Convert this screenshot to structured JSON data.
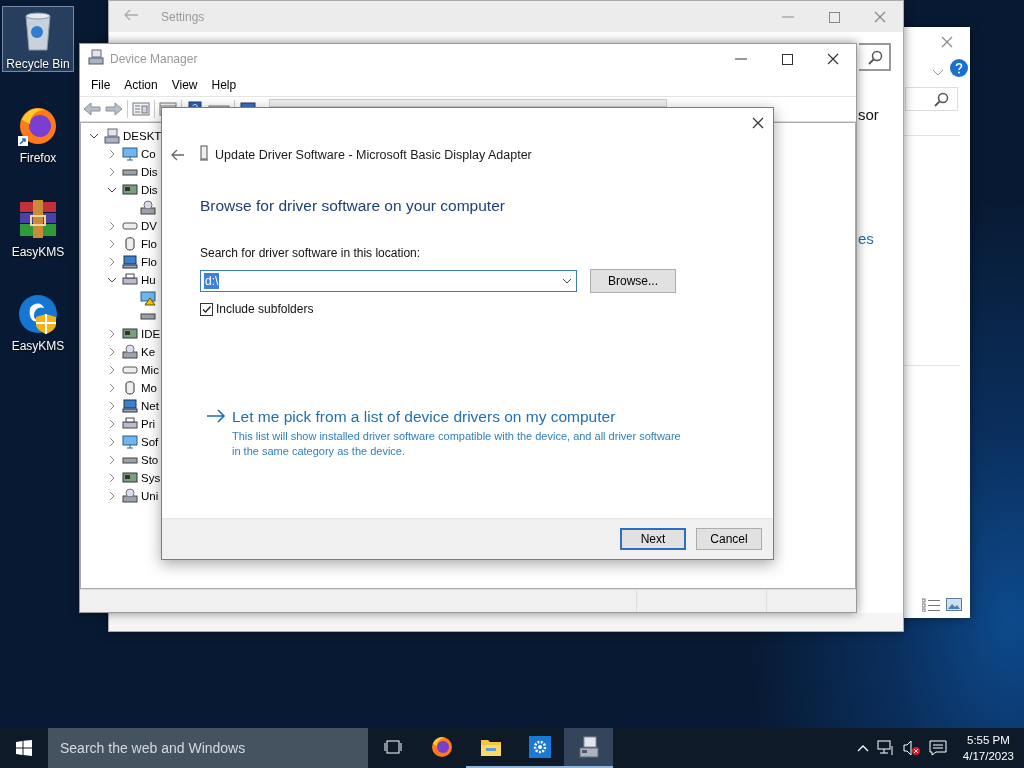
{
  "desktop_icons": [
    {
      "label": "Recycle Bin",
      "kind": "recycle-bin",
      "selected": true
    },
    {
      "label": "Firefox",
      "kind": "firefox",
      "selected": false
    },
    {
      "label": "EasyKMS",
      "kind": "archive",
      "selected": false
    },
    {
      "label": "EasyKMS",
      "kind": "shield-app",
      "selected": false
    }
  ],
  "settings_window": {
    "title": "Settings",
    "partial_text": "sor",
    "partial_link": "es"
  },
  "device_manager": {
    "title": "Device Manager",
    "menu": [
      "File",
      "Action",
      "View",
      "Help"
    ],
    "tree": {
      "label": "DESKT",
      "expanded": true,
      "children": [
        {
          "label": "Co",
          "expanded": false
        },
        {
          "label": "Dis",
          "expanded": false
        },
        {
          "label": "Dis",
          "expanded": true,
          "children": [
            {
              "warning": false
            }
          ]
        },
        {
          "label": "DV",
          "expanded": false
        },
        {
          "label": "Flo",
          "expanded": false
        },
        {
          "label": "Flo",
          "expanded": false
        },
        {
          "label": "Hu",
          "expanded": true,
          "children": [
            {
              "warning": true
            },
            {
              "warning": false
            }
          ]
        },
        {
          "label": "IDE",
          "expanded": false
        },
        {
          "label": "Ke",
          "expanded": false
        },
        {
          "label": "Mic",
          "expanded": false
        },
        {
          "label": "Mo",
          "expanded": false
        },
        {
          "label": "Net",
          "expanded": false
        },
        {
          "label": "Pri",
          "expanded": false
        },
        {
          "label": "Sof",
          "expanded": false
        },
        {
          "label": "Sto",
          "expanded": false
        },
        {
          "label": "Sys",
          "expanded": false
        },
        {
          "label": "Uni",
          "expanded": false
        }
      ]
    }
  },
  "dialog": {
    "title": "Update Driver Software - Microsoft Basic Display Adapter",
    "heading": "Browse for driver software on your computer",
    "location_label": "Search for driver software in this location:",
    "location": {
      "value": "d:\\",
      "text_selected": true
    },
    "browse_button": "Browse...",
    "include_subfolders": {
      "label": "Include subfolders",
      "checked": true
    },
    "pick_link": {
      "title": "Let me pick from a list of device drivers on my computer",
      "description": "This list will show installed driver software compatible with the device, and all driver software in the same category as the device."
    },
    "buttons": [
      {
        "label": "Next",
        "default": true
      },
      {
        "label": "Cancel",
        "default": false
      }
    ]
  },
  "taskbar": {
    "search": {
      "placeholder": "Search the web and Windows"
    },
    "apps": [
      {
        "kind": "task-view",
        "running": false,
        "selected": false
      },
      {
        "kind": "firefox",
        "running": false,
        "selected": false
      },
      {
        "kind": "explorer",
        "running": true,
        "selected": false
      },
      {
        "kind": "settings",
        "running": true,
        "selected": false
      },
      {
        "kind": "device-manager",
        "running": true,
        "selected": true
      }
    ],
    "time": "5:55 PM",
    "date": "4/17/2023"
  }
}
